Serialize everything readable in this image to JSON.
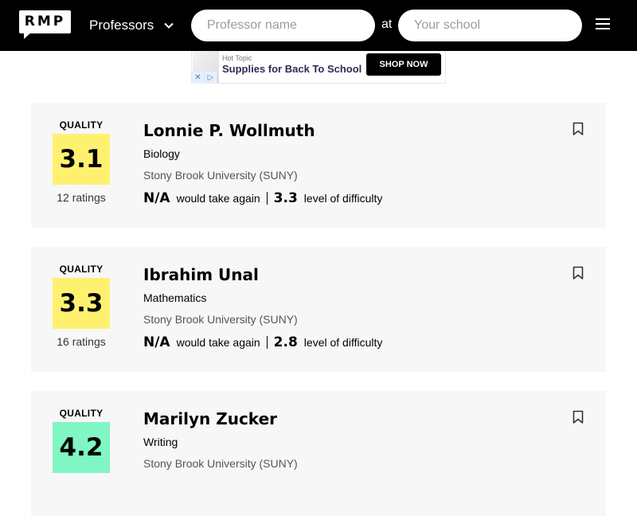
{
  "header": {
    "logo_text": "RMP",
    "nav_label": "Professors",
    "professor_search_placeholder": "Professor name",
    "at_label": "at",
    "school_search_placeholder": "Your school"
  },
  "ad": {
    "brand": "Hot Topic",
    "headline": "Supplies for Back To School",
    "button_label": "SHOP NOW",
    "choice_icons": [
      "✕",
      "▷"
    ]
  },
  "labels": {
    "quality": "QUALITY",
    "would_take_again": "would take again",
    "level_of_difficulty": "level of difficulty"
  },
  "professors": [
    {
      "name": "Lonnie P. Wollmuth",
      "department": "Biology",
      "school": "Stony Brook University (SUNY)",
      "quality": "3.1",
      "quality_color": "#fff170",
      "ratings": "12 ratings",
      "would_take_again": "N/A",
      "difficulty": "3.3"
    },
    {
      "name": "Ibrahim Unal",
      "department": "Mathematics",
      "school": "Stony Brook University (SUNY)",
      "quality": "3.3",
      "quality_color": "#fff170",
      "ratings": "16 ratings",
      "would_take_again": "N/A",
      "difficulty": "2.8"
    },
    {
      "name": "Marilyn Zucker",
      "department": "Writing",
      "school": "Stony Brook University (SUNY)",
      "quality": "4.2",
      "quality_color": "#7ff6c3",
      "ratings": "",
      "would_take_again": "",
      "difficulty": ""
    }
  ]
}
